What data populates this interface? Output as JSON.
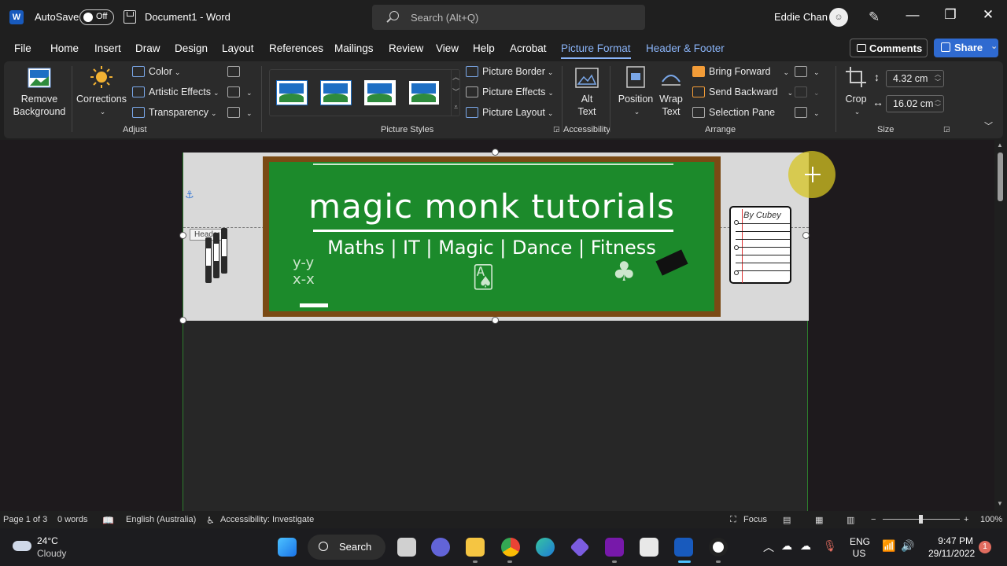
{
  "titlebar": {
    "autosave_label": "AutoSave",
    "autosave_state": "Off",
    "document_title": "Document1  -  Word",
    "search_placeholder": "Search (Alt+Q)",
    "user_name": "Eddie Chan",
    "minimize": "—",
    "restore": "❐",
    "close": "✕"
  },
  "tabs": [
    "File",
    "Home",
    "Insert",
    "Draw",
    "Design",
    "Layout",
    "References",
    "Mailings",
    "Review",
    "View",
    "Help",
    "Acrobat",
    "Picture Format",
    "Header & Footer"
  ],
  "active_tab": "Picture Format",
  "actions": {
    "comments": "Comments",
    "share": "Share"
  },
  "ribbon": {
    "remove_background": [
      "Remove",
      "Background"
    ],
    "corrections": "Corrections",
    "color": "Color",
    "artistic_effects": "Artistic Effects",
    "transparency": "Transparency",
    "group_adjust": "Adjust",
    "picture_border": "Picture Border",
    "picture_effects": "Picture Effects",
    "picture_layout": "Picture Layout",
    "group_picture_styles": "Picture Styles",
    "alt_text": [
      "Alt",
      "Text"
    ],
    "group_accessibility": "Accessibility",
    "position": "Position",
    "wrap_text": [
      "Wrap",
      "Text"
    ],
    "bring_forward": "Bring Forward",
    "send_backward": "Send Backward",
    "selection_pane": "Selection Pane",
    "group_arrange": "Arrange",
    "crop": "Crop",
    "height": "4.32 cm",
    "width": "16.02 cm",
    "group_size": "Size"
  },
  "document": {
    "header_tag": "Header",
    "board_title": "magic monk tutorials",
    "board_subtitle": "Maths | IT | Magic | Dance | Fitness",
    "notepad_signature": "By Cubey"
  },
  "statusbar": {
    "page": "Page 1 of 3",
    "words": "0 words",
    "language": "English (Australia)",
    "accessibility": "Accessibility: Investigate",
    "focus": "Focus",
    "zoom": "100%"
  },
  "taskbar": {
    "temperature": "24°C",
    "weather": "Cloudy",
    "search": "Search",
    "lang_1": "ENG",
    "lang_2": "US",
    "time": "9:47 PM",
    "date": "29/11/2022",
    "notifications": "1"
  },
  "colors": {
    "accent": "#8ab4f8",
    "share": "#2f6ad0",
    "board_green": "#1c8a2b",
    "board_frame": "#7a4a14"
  }
}
